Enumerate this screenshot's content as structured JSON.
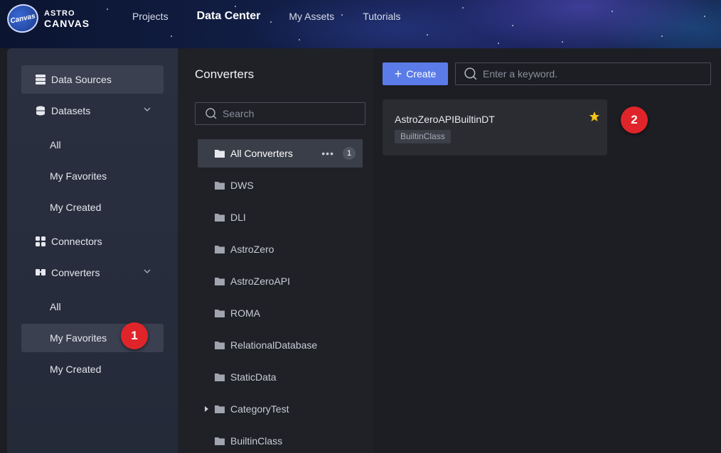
{
  "brand": {
    "badge": "Canvas",
    "line1": "ASTRO",
    "line2": "CANVAS"
  },
  "nav": {
    "items": [
      {
        "label": "Projects",
        "active": false
      },
      {
        "label": "Data Center",
        "active": true
      },
      {
        "label": "My Assets",
        "active": false
      },
      {
        "label": "Tutorials",
        "active": false
      }
    ]
  },
  "sidebar": {
    "data_sources": "Data Sources",
    "datasets": {
      "label": "Datasets",
      "children": [
        "All",
        "My Favorites",
        "My Created"
      ]
    },
    "connectors": "Connectors",
    "converters": {
      "label": "Converters",
      "children": [
        "All",
        "My Favorites",
        "My Created"
      ],
      "selected": "My Favorites"
    }
  },
  "middle": {
    "title": "Converters",
    "search_placeholder": "Search",
    "tree": [
      {
        "label": "All Converters",
        "count": "1",
        "selected": true
      },
      {
        "label": "DWS"
      },
      {
        "label": "DLI"
      },
      {
        "label": "AstroZero"
      },
      {
        "label": "AstroZeroAPI"
      },
      {
        "label": "ROMA"
      },
      {
        "label": "RelationalDatabase"
      },
      {
        "label": "StaticData"
      },
      {
        "label": "CategoryTest",
        "expandable": true
      },
      {
        "label": "BuiltinClass"
      }
    ]
  },
  "main": {
    "create_label": "Create",
    "search_placeholder": "Enter a keyword.",
    "cards": [
      {
        "title": "AstroZeroAPIBuiltinDT",
        "tag": "BuiltinClass",
        "favorited": true
      }
    ]
  },
  "markers": [
    "1",
    "2"
  ],
  "colors": {
    "accent": "#5b7be8",
    "star": "#f5c518",
    "marker": "#e0252a"
  }
}
